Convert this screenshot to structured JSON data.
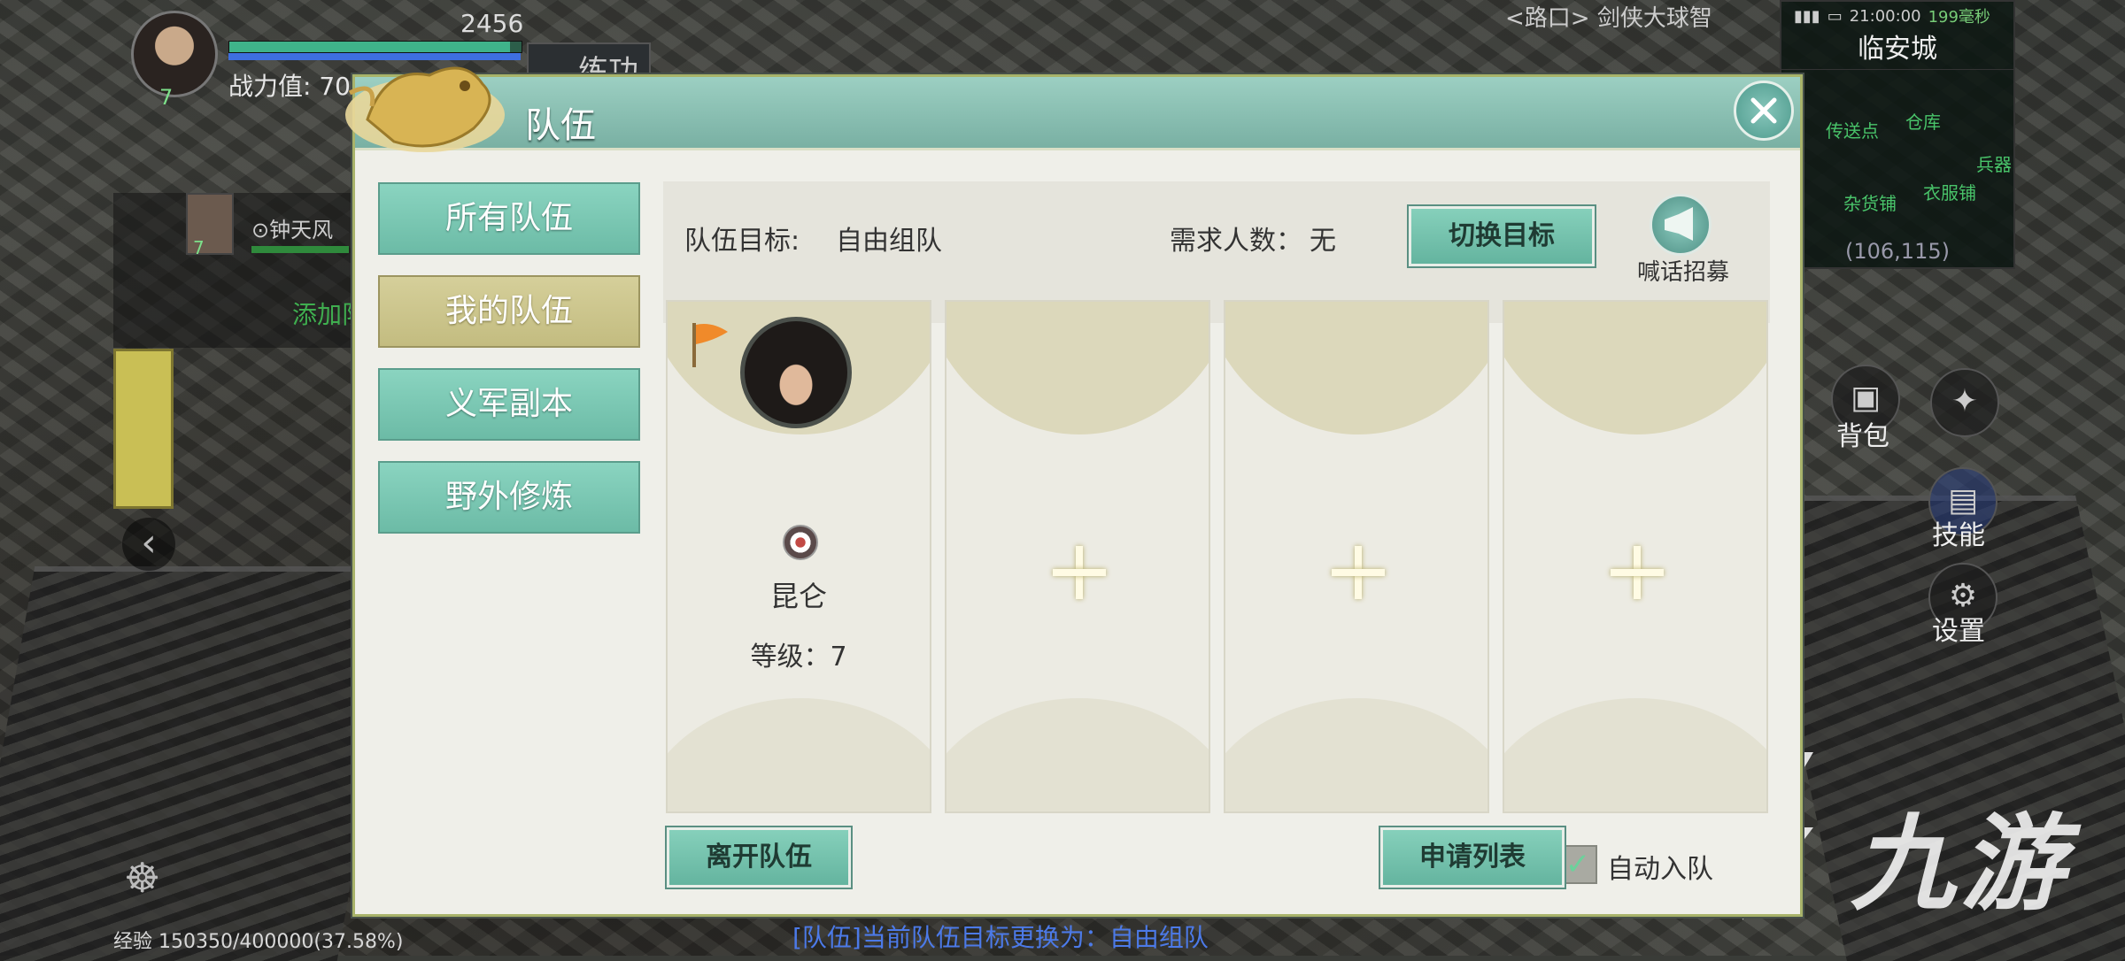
{
  "hud": {
    "hp_number": "2456",
    "power_label": "战力值: 70",
    "practice_label": "练功",
    "player_level": "7",
    "member_name": "⊙钟天风",
    "member_level": "7",
    "add_member_label": "添加队",
    "exp_text": "经验 150350/400000(37.58%)",
    "system_message": "[队伍]当前队伍目标更换为：自由组队",
    "top_mid_text": "<路口>  剑侠大球智",
    "minimap": {
      "time": "21:00:00",
      "latency": "199毫秒",
      "name": "临安城",
      "labels": [
        "衣服铺",
        "杂货铺",
        "兵器",
        "仓库",
        "传送点"
      ],
      "coords": "(106,115)"
    },
    "bag_label": "背包",
    "skill_label": "技能",
    "settings_label": "设置",
    "watermark": "九游"
  },
  "dialog": {
    "title": "队伍",
    "tabs": [
      {
        "label": "所有队伍",
        "active": false
      },
      {
        "label": "我的队伍",
        "active": true
      },
      {
        "label": "义军副本",
        "active": false
      },
      {
        "label": "野外修炼",
        "active": false
      }
    ],
    "goal_label": "队伍目标:",
    "goal_value": "自由组队",
    "need_label": "需求人数：",
    "need_value": "无",
    "switch_target_label": "切换目标",
    "shout_label": "喊话招募",
    "member": {
      "school": "昆仑",
      "level_text": "等级：7"
    },
    "leave_label": "离开队伍",
    "auto_join_label": "自动入队",
    "auto_join_checked": true,
    "apply_list_label": "申请列表"
  },
  "colors": {
    "accent_teal": "#6cbba6",
    "active_tab": "#c3bc80",
    "title_bar": "#79b0a3"
  }
}
